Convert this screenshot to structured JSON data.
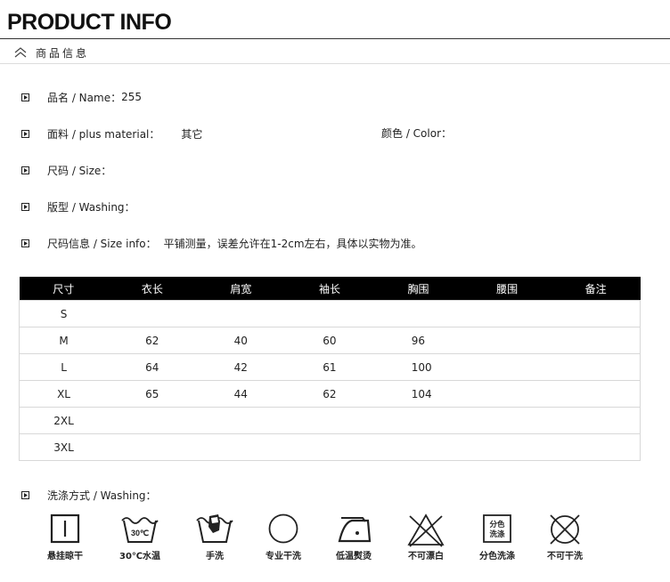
{
  "header": {
    "title": "PRODUCT INFO",
    "subtitle": "商品信息"
  },
  "info": {
    "name_label": "品名 / Name：",
    "name_value": "255",
    "material_label": "面料 / plus material：",
    "material_value": "其它",
    "color_label": "颜色 / Color：",
    "size_label": "尺码 / Size：",
    "fit_label": "版型 / Washing：",
    "sizeinfo_label": "尺码信息 / Size info：",
    "sizeinfo_value": "平铺测量，误差允许在1-2cm左右，具体以实物为准。"
  },
  "table": {
    "headers": [
      "尺寸",
      "衣长",
      "肩宽",
      "袖长",
      "胸围",
      "腰围",
      "备注"
    ],
    "rows": [
      [
        "S",
        "",
        "",
        "",
        "",
        "",
        ""
      ],
      [
        "M",
        "62",
        "40",
        "60",
        "96",
        "",
        ""
      ],
      [
        "L",
        "64",
        "42",
        "61",
        "100",
        "",
        ""
      ],
      [
        "XL",
        "65",
        "44",
        "62",
        "104",
        "",
        ""
      ],
      [
        "2XL",
        "",
        "",
        "",
        "",
        "",
        ""
      ],
      [
        "3XL",
        "",
        "",
        "",
        "",
        "",
        ""
      ]
    ]
  },
  "care": {
    "label": "洗涤方式 / Washing：",
    "temp_text": "30℃",
    "sep_text_1": "分色",
    "sep_text_2": "洗涤",
    "icons": [
      {
        "icon": "hang-dry-icon",
        "label": "悬挂晾干"
      },
      {
        "icon": "wash-30-icon",
        "label": "30℃水温"
      },
      {
        "icon": "hand-wash-icon",
        "label": "手洗"
      },
      {
        "icon": "dry-clean-icon",
        "label": "专业干洗"
      },
      {
        "icon": "iron-low-icon",
        "label": "低温熨烫"
      },
      {
        "icon": "no-bleach-icon",
        "label": "不可漂白"
      },
      {
        "icon": "wash-separately-icon",
        "label": "分色洗涤"
      },
      {
        "icon": "no-tumble-dry-icon",
        "label": "不可干洗"
      }
    ]
  }
}
